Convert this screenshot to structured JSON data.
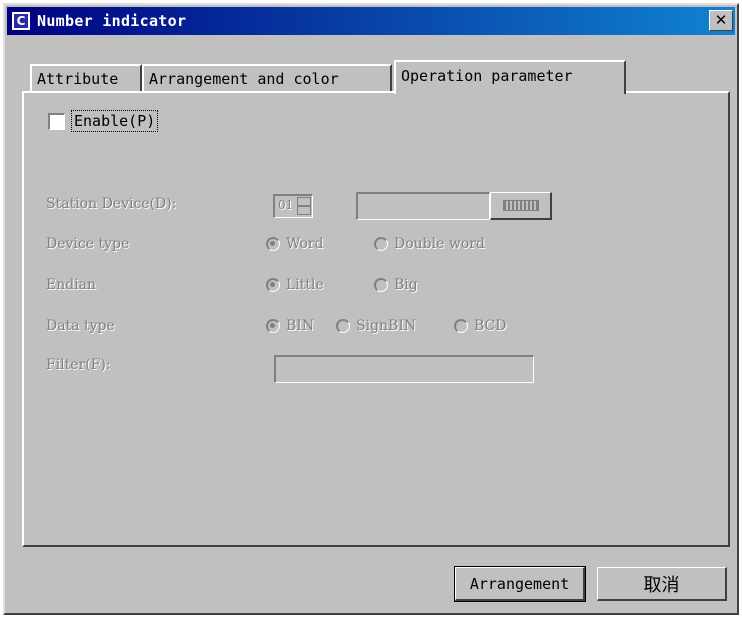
{
  "window": {
    "title": "Number indicator",
    "close_glyph": "✕"
  },
  "tabs": [
    {
      "label": "Attribute"
    },
    {
      "label": "Arrangement and color"
    },
    {
      "label": "Operation parameter",
      "active": true
    }
  ],
  "enable": {
    "label": "Enable(P)",
    "checked": false
  },
  "station_device": {
    "label": "Station Device(D):",
    "value": "01",
    "text_value": ""
  },
  "device_type": {
    "label": "Device type",
    "options": [
      "Word",
      "Double word"
    ],
    "selected": "Word"
  },
  "endian": {
    "label": "Endian",
    "options": [
      "Little",
      "Big"
    ],
    "selected": "Little"
  },
  "data_type": {
    "label": "Data type",
    "options": [
      "BIN",
      "SignBIN",
      "BCD"
    ],
    "selected": "BIN"
  },
  "filter": {
    "label": "Filter(F):",
    "value": ""
  },
  "buttons": {
    "arrangement": "Arrangement",
    "cancel": "取消"
  },
  "colors": {
    "titlebar_start": "#000080",
    "titlebar_end": "#1084d0",
    "face": "#c0c0c0",
    "disabled_text": "#808080"
  },
  "icons": {
    "app": "app-c-icon",
    "close": "close-icon",
    "keyboard": "keyboard-icon",
    "spinner": "spinner-arrows-icon"
  }
}
